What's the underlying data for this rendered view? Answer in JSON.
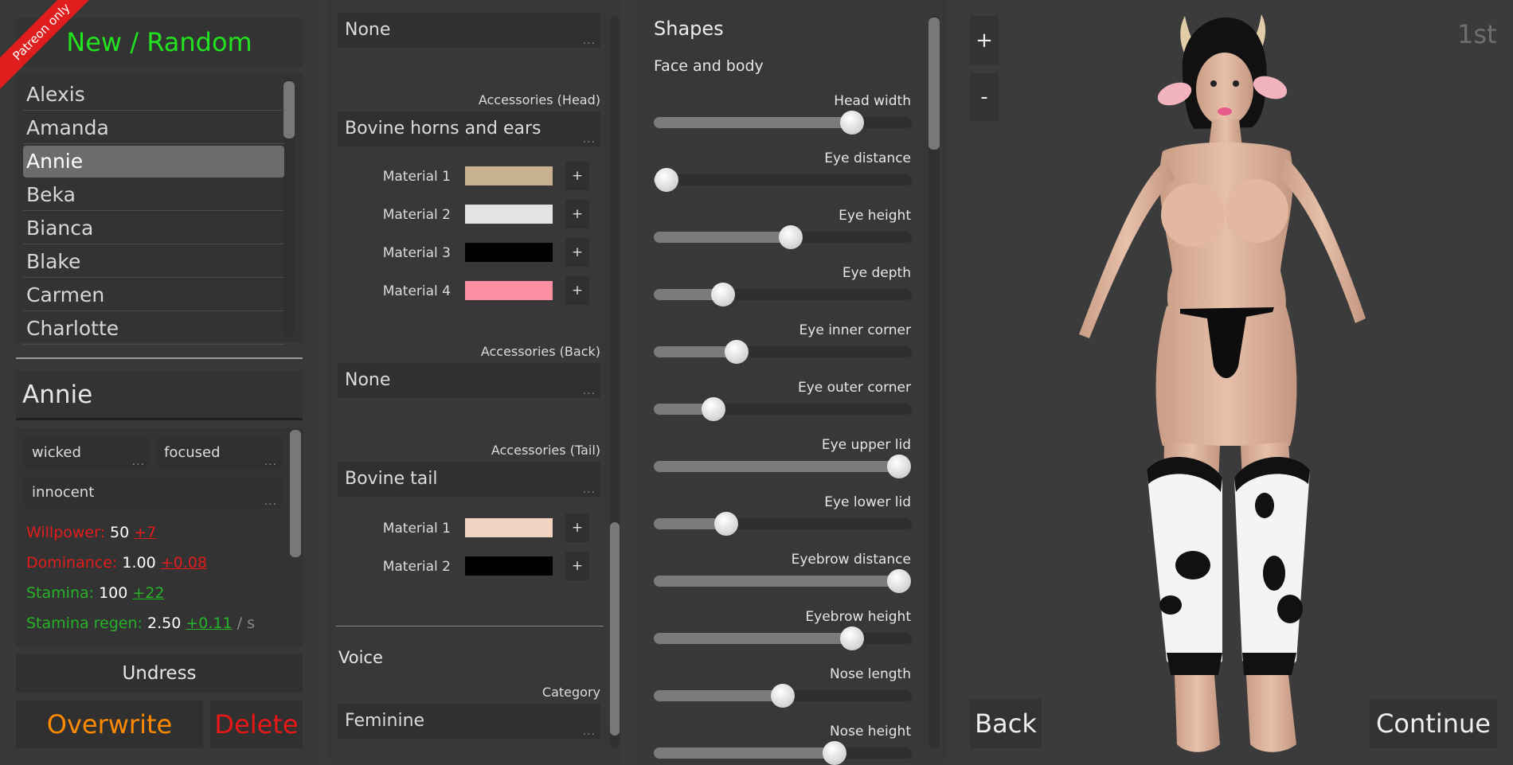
{
  "left": {
    "ribbon": "Patreon only",
    "new_random": "New / Random",
    "characters": [
      "Alexis",
      "Amanda",
      "Annie",
      "Beka",
      "Bianca",
      "Blake",
      "Carmen",
      "Charlotte"
    ],
    "selected_index": 2,
    "name_field": "Annie",
    "traits": [
      "wicked",
      "focused",
      "innocent"
    ],
    "stats": {
      "willpower": {
        "label": "Willpower:",
        "value": "50",
        "delta": "+7"
      },
      "dominance": {
        "label": "Dominance:",
        "value": "1.00",
        "delta": "+0.08"
      },
      "stamina": {
        "label": "Stamina:",
        "value": "100",
        "delta": "+22"
      },
      "stamina_regen": {
        "label": "Stamina regen:",
        "value": "2.50",
        "delta": "+0.11",
        "unit": "/ s"
      }
    },
    "undress": "Undress",
    "overwrite": "Overwrite",
    "delete": "Delete"
  },
  "mid": {
    "top_dropdown": "None",
    "acc_head_label": "Accessories (Head)",
    "acc_head_value": "Bovine horns and ears",
    "head_materials": [
      {
        "label": "Material 1",
        "color": "#c7b190"
      },
      {
        "label": "Material 2",
        "color": "#e3e3e3"
      },
      {
        "label": "Material 3",
        "color": "#000000"
      },
      {
        "label": "Material 4",
        "color": "#fc8fa1"
      }
    ],
    "acc_back_label": "Accessories (Back)",
    "acc_back_value": "None",
    "acc_tail_label": "Accessories (Tail)",
    "acc_tail_value": "Bovine tail",
    "tail_materials": [
      {
        "label": "Material 1",
        "color": "#f2d2c1"
      },
      {
        "label": "Material 2",
        "color": "#000000"
      }
    ],
    "plus": "+",
    "voice_title": "Voice",
    "category_label": "Category",
    "category_value": "Feminine"
  },
  "shapes": {
    "title": "Shapes",
    "subtitle": "Face and body",
    "sliders": [
      {
        "label": "Head width",
        "value": 0.77
      },
      {
        "label": "Eye distance",
        "value": 0.05
      },
      {
        "label": "Eye height",
        "value": 0.53
      },
      {
        "label": "Eye depth",
        "value": 0.27
      },
      {
        "label": "Eye inner corner",
        "value": 0.32
      },
      {
        "label": "Eye outer corner",
        "value": 0.23
      },
      {
        "label": "Eye upper lid",
        "value": 0.95
      },
      {
        "label": "Eye lower lid",
        "value": 0.28
      },
      {
        "label": "Eyebrow distance",
        "value": 0.95
      },
      {
        "label": "Eyebrow height",
        "value": 0.77
      },
      {
        "label": "Nose length",
        "value": 0.5
      },
      {
        "label": "Nose height",
        "value": 0.7
      }
    ]
  },
  "viewer": {
    "zoom_in": "+",
    "zoom_out": "-",
    "camera_mode": "1st",
    "back": "Back",
    "continue": "Continue"
  }
}
